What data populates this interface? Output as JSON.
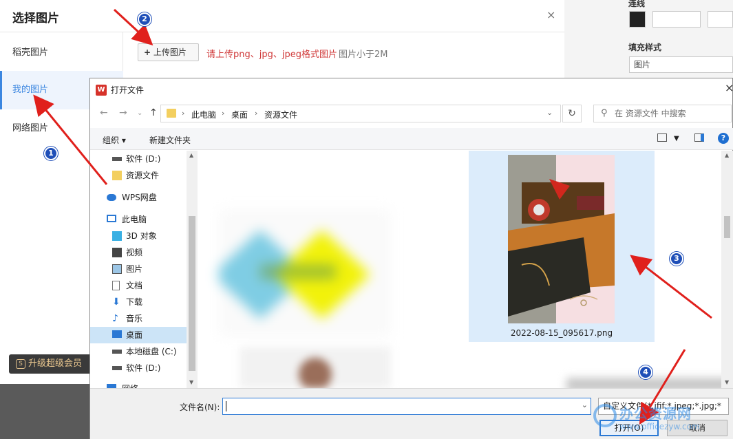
{
  "right_panel": {
    "line_label": "连线",
    "fill_style_label": "填充样式",
    "fill_value": "图片"
  },
  "pic_dialog": {
    "title": "选择图片",
    "close": "×",
    "side_items": [
      "稻壳图片",
      "我的图片",
      "网络图片"
    ],
    "active_index": 1,
    "upload_label": "上传图片",
    "upload_hint": "请上传png、jpg、jpeg格式图片",
    "upload_limit": "图片小于2M",
    "upgrade_label": "升级超级会员"
  },
  "open_dialog": {
    "title": "打开文件",
    "logo_text": "W",
    "close": "×",
    "breadcrumb": [
      "此电脑",
      "桌面",
      "资源文件"
    ],
    "search_placeholder": "在 资源文件 中搜索",
    "organize_label": "组织 ▾",
    "new_folder_label": "新建文件夹",
    "help": "?",
    "tree": [
      {
        "label": "软件 (D:)",
        "icon": "drive-icon"
      },
      {
        "label": "资源文件",
        "icon": "folder-icon"
      },
      {
        "label": "WPS网盘",
        "icon": "cloud-icon"
      },
      {
        "label": "此电脑",
        "icon": "computer-icon"
      },
      {
        "label": "3D 对象",
        "icon": "cube-icon"
      },
      {
        "label": "视频",
        "icon": "video-icon"
      },
      {
        "label": "图片",
        "icon": "picture-icon"
      },
      {
        "label": "文档",
        "icon": "document-icon"
      },
      {
        "label": "下载",
        "icon": "download-icon"
      },
      {
        "label": "音乐",
        "icon": "music-icon"
      },
      {
        "label": "桌面",
        "icon": "desktop-icon"
      },
      {
        "label": "本地磁盘 (C:)",
        "icon": "disk-icon"
      },
      {
        "label": "软件 (D:)",
        "icon": "drive-icon"
      },
      {
        "label": "网络",
        "icon": "network-icon"
      }
    ],
    "selected_tree_index": 10,
    "selected_file": "2022-08-15_095617.png",
    "filename_label": "文件名(N):",
    "filename_value": "",
    "filetype": "自定义文件(*.jfif;*.jpeg;*.jpg;*",
    "open_label": "打开(O)",
    "cancel_label": "取消"
  },
  "annotations": [
    "1",
    "2",
    "3",
    "4"
  ],
  "watermark": {
    "text": "办公资源网",
    "sub": "www.officezyw.com"
  },
  "colors": {
    "accent": "#3b86e0",
    "arrow": "#e0201c",
    "badge": "#1f4fb8",
    "hint": "#d03a3a"
  }
}
